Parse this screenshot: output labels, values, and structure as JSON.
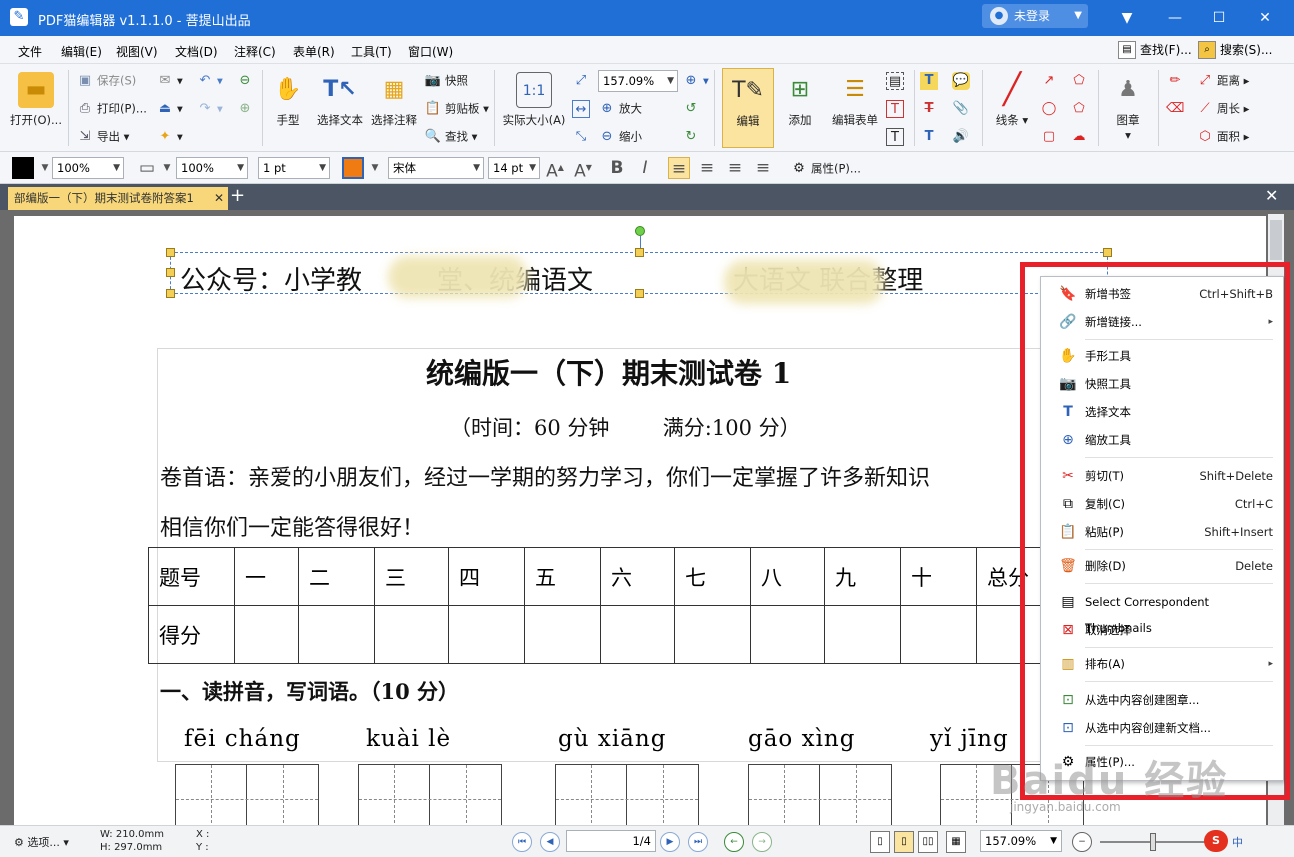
{
  "app": {
    "title": "PDF猫编辑器 v1.1.1.0 - 菩提山出品",
    "login": "未登录"
  },
  "menu": [
    "文件",
    "编辑(E)",
    "视图(V)",
    "文档(D)",
    "注释(C)",
    "表单(R)",
    "工具(T)",
    "窗口(W)"
  ],
  "menu_right": {
    "find": "查找(F)...",
    "search": "搜索(S)..."
  },
  "toolbar": {
    "open": "打开(O)...",
    "save": "保存(S)",
    "print": "打印(P)...",
    "export": "导出",
    "hand": "手型",
    "select_text": "选择文本",
    "select_annot": "选择注释",
    "snapshot": "快照",
    "clipboard": "剪贴板",
    "find": "查找",
    "actual_size": "实际大小(A)",
    "zoom_value": "157.09%",
    "zoom_in": "放大",
    "zoom_out": "缩小",
    "edit": "编辑",
    "add": "添加",
    "edit_form": "编辑表单",
    "line": "线条",
    "stamp": "图章",
    "distance": "距离",
    "perimeter": "周长",
    "area": "面积"
  },
  "format": {
    "opacity1": "100%",
    "opacity2": "100%",
    "line_width": "1 pt",
    "font": "宋体",
    "font_size": "14 pt",
    "properties": "属性(P)..."
  },
  "tab": {
    "title": "部编版一（下）期末测试卷附答案1"
  },
  "document": {
    "header": "公众号：小学教",
    "header_mid": "堂、统编语文",
    "header_end": "大语文 联合整理",
    "title": "统编版一（下）期末测试卷 1",
    "subtitle": "（时间：60 分钟        满分:100 分）",
    "intro1": "卷首语：亲爱的小朋友们，经过一学期的努力学习，你们一定掌握了许多新知识",
    "intro2": "相信你们一定能答得很好！",
    "table_header": [
      "题号",
      "一",
      "二",
      "三",
      "四",
      "五",
      "六",
      "七",
      "八",
      "九",
      "十",
      "总分"
    ],
    "table_row2": [
      "得分"
    ],
    "section1": "一、读拼音，写词语。（10 分）",
    "pinyin": [
      "fēi cháng",
      "kuài lè",
      "gù xiāng",
      "gāo xìng",
      "yǐ jīng"
    ]
  },
  "context_menu": [
    {
      "label": "新增书签",
      "key": "Ctrl+Shift+B",
      "icon": "bookmark-add-icon"
    },
    {
      "label": "新增链接...",
      "key": "▸",
      "icon": "link-add-icon"
    },
    {
      "label": "手形工具",
      "key": "",
      "icon": "hand-icon"
    },
    {
      "label": "快照工具",
      "key": "",
      "icon": "camera-icon"
    },
    {
      "label": "选择文本",
      "key": "",
      "icon": "select-text-icon"
    },
    {
      "label": "缩放工具",
      "key": "",
      "icon": "zoom-icon"
    },
    {
      "label": "剪切(T)",
      "key": "Shift+Delete",
      "icon": "scissors-icon"
    },
    {
      "label": "复制(C)",
      "key": "Ctrl+C",
      "icon": "copy-icon"
    },
    {
      "label": "粘贴(P)",
      "key": "Shift+Insert",
      "icon": "paste-icon"
    },
    {
      "label": "删除(D)",
      "key": "Delete",
      "icon": "trash-icon"
    },
    {
      "label": "Select Correspondent Thumbnails",
      "key": "",
      "icon": "thumbnails-icon"
    },
    {
      "label": "取消选择",
      "key": "",
      "icon": "deselect-icon"
    },
    {
      "label": "排布(A)",
      "key": "▸",
      "icon": "arrange-icon"
    },
    {
      "label": "从选中内容创建图章...",
      "key": "",
      "icon": "stamp-create-icon"
    },
    {
      "label": "从选中内容创建新文档...",
      "key": "",
      "icon": "doc-create-icon"
    },
    {
      "label": "属性(P)...",
      "key": "",
      "icon": "properties-icon"
    }
  ],
  "status": {
    "options": "选项...",
    "width": "W: 210.0mm",
    "height": "H: 297.0mm",
    "x": "X :",
    "y": "Y :",
    "page": "1/4",
    "zoom": "157.09%"
  },
  "watermark": {
    "main": "Baidu 经验",
    "sub": "jingyan.baidu.com"
  },
  "colors": {
    "titlebar": "#1f6fd6",
    "highlight_frame": "#e8202a",
    "tab": "#f7d77a"
  }
}
